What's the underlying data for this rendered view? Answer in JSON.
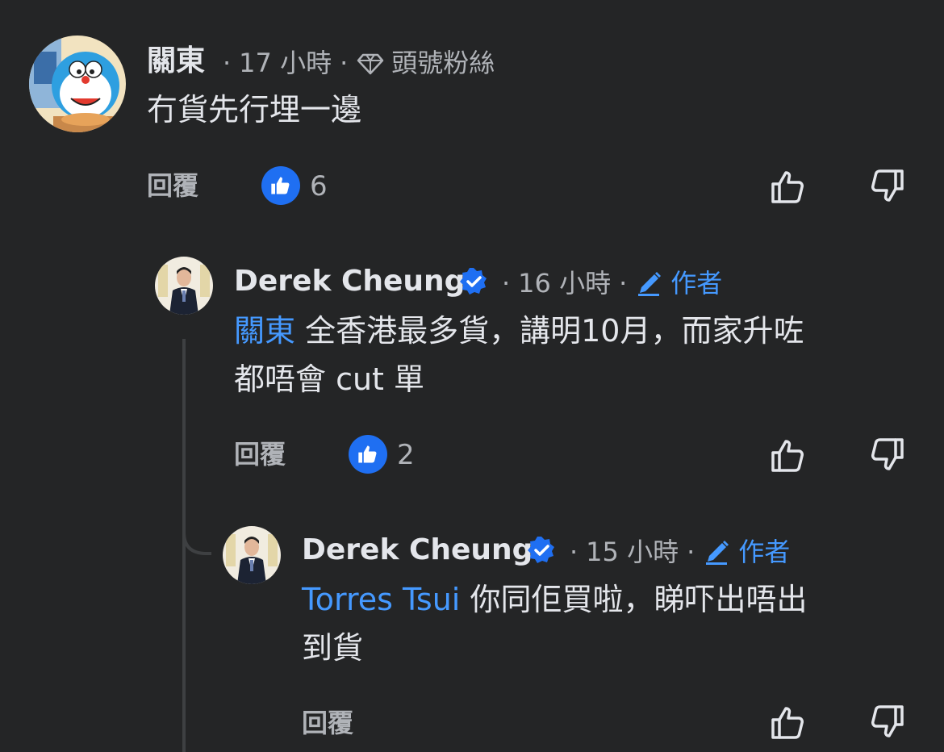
{
  "comments": [
    {
      "author": "關東",
      "time": "17 小時",
      "badge_label": "頭號粉絲",
      "badge_icon": "diamond-icon",
      "text": "冇貨先行埋一邊",
      "reply_label": "回覆",
      "like_count": "6"
    },
    {
      "author": "Derek Cheung",
      "verified": true,
      "time": "16 小時",
      "badge_label": "作者",
      "badge_icon": "pencil-icon",
      "mention": "關東",
      "text_line1": " 全香港最多貨，講明10月，而家升咗",
      "text_line2": "都唔會 cut 單",
      "reply_label": "回覆",
      "like_count": "2"
    },
    {
      "author": "Derek Cheung",
      "verified": true,
      "time": "15 小時",
      "badge_label": "作者",
      "badge_icon": "pencil-icon",
      "mention": "Torres Tsui",
      "text_line1": " 你同佢買啦，睇吓出唔出",
      "text_line2": "到貨",
      "reply_label": "回覆"
    }
  ],
  "colors": {
    "background": "#242526",
    "mention": "#4599ff",
    "like_badge": "#1f6ff2",
    "verified": "#1f6ff2",
    "muted": "#b0b3b8"
  },
  "separator": "·"
}
